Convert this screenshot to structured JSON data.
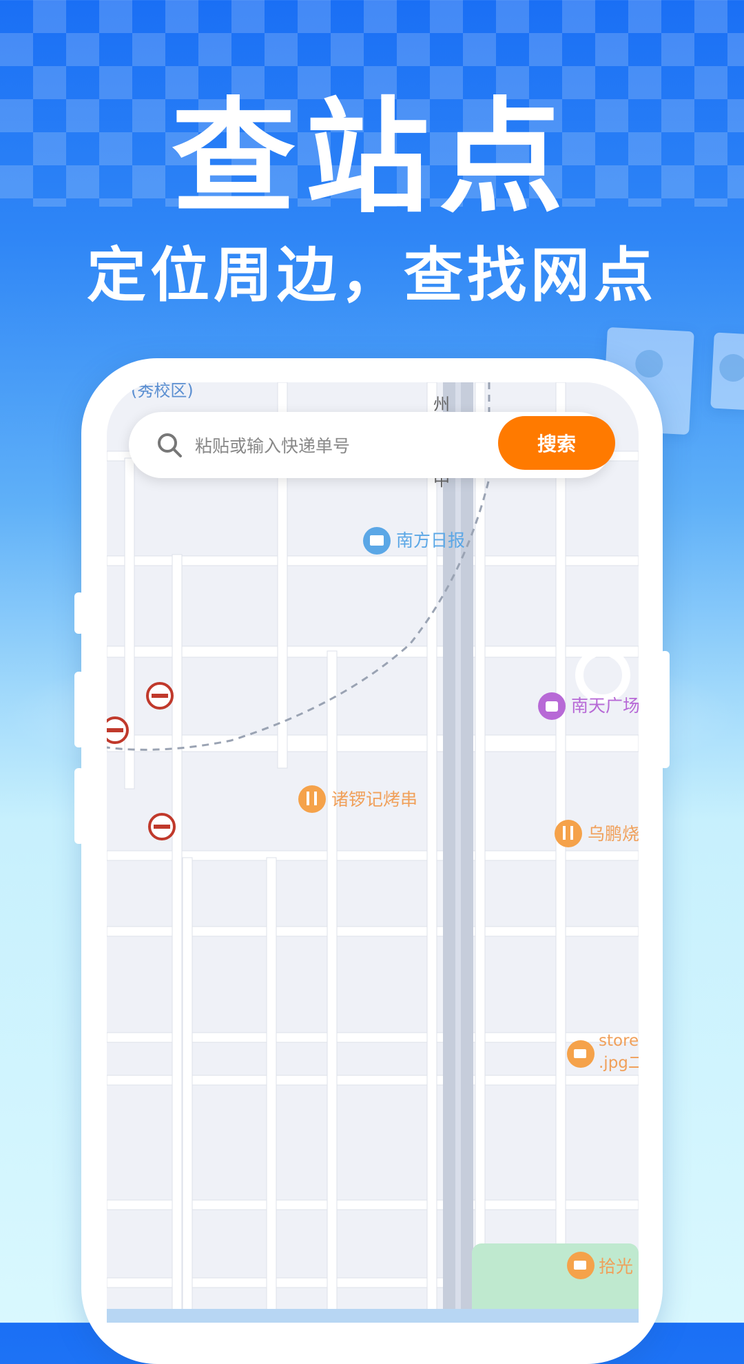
{
  "hero": {
    "title": "查站点",
    "subtitle": "定位周边，查找网点"
  },
  "search": {
    "placeholder": "粘贴或输入快递单号",
    "button_label": "搜索"
  },
  "map": {
    "labels": {
      "top_left_area": "(秀校区)",
      "street_top_1": "州",
      "street_top_2": "中",
      "poi_newspaper": "南方日报",
      "poi_mall": "南天广场",
      "poi_restaurant_1": "诸锣记烤串",
      "poi_restaurant_2": "乌鹏烧",
      "poi_store_1": "store",
      "poi_store_2": ".jpg二",
      "poi_cafe": "拾光"
    },
    "colors": {
      "road": "#ffffff",
      "block": "#eff1f7",
      "main_road": "#c6cddb",
      "poi_blue": "#5ba7e6",
      "poi_orange": "#f5a24a",
      "poi_purple": "#b769d6",
      "park": "#bfe9cf",
      "accent": "#ff7a00"
    }
  }
}
